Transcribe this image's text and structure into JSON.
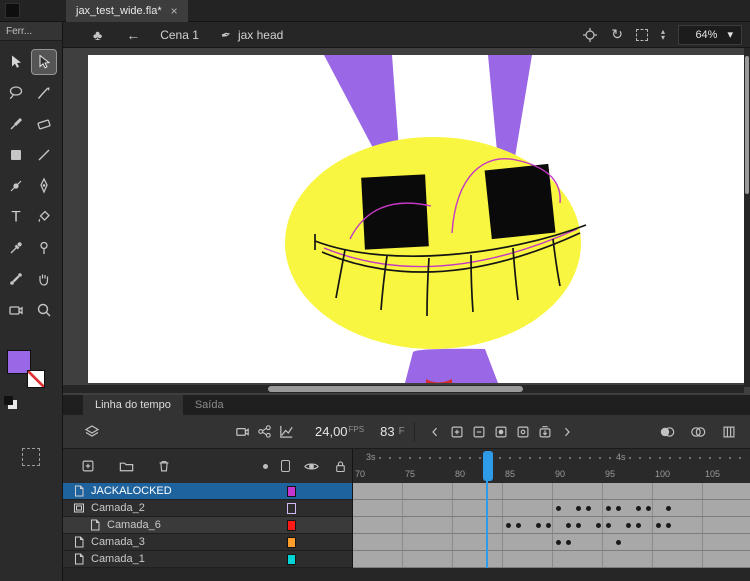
{
  "window": {
    "doc_tab": "jax_test_wide.fla*",
    "close": "×"
  },
  "tools_panel": {
    "title": "Ferr...",
    "tools": [
      "selection-tool",
      "subselection-tool",
      "lasso-tool",
      "fluid-brush-tool",
      "classic-brush-tool",
      "eraser-tool",
      "rectangle-tool",
      "line-tool",
      "width-tool",
      "pen-tool",
      "text-tool",
      "paint-bucket-tool",
      "eyedropper-tool",
      "asset-warp-tool",
      "bone-tool",
      "hand-tool",
      "camera-tool",
      "zoom-tool"
    ],
    "text_tool_glyph": "T"
  },
  "edit_bar": {
    "club_glyph": "♣",
    "back_glyph": "←",
    "scene_name": "Cena 1",
    "symbol_glyph": "✒",
    "symbol_name": "jax head",
    "rotate_glyph": "↻",
    "spinner_up": "▴",
    "spinner_down": "▾",
    "zoom_value": "64%",
    "zoom_caret": "▾"
  },
  "timeline": {
    "tabs": {
      "timeline": "Linha do tempo",
      "output": "Saída"
    },
    "fps_value": "24,00",
    "fps_unit": "FPS",
    "current_frame": "83",
    "frame_unit": "F",
    "first_frame": 70,
    "playhead_frame": 83,
    "ruler_numbers": [
      70,
      75,
      80,
      85,
      90,
      95,
      100,
      105
    ],
    "seconds_markers": [
      {
        "label": "3s",
        "frame": 71
      },
      {
        "label": "4s",
        "frame": 96
      }
    ],
    "layers": [
      {
        "name": "JACKALOCKED",
        "swatch": "#c436cf",
        "selected": true,
        "hollow": false,
        "indent": 0,
        "keyframes": []
      },
      {
        "name": "Camada_2",
        "swatch": "#cdb9f5",
        "selected": false,
        "hollow": true,
        "indent": 0,
        "keyframes": [
          90,
          92,
          93,
          95,
          96,
          98,
          99,
          101
        ]
      },
      {
        "name": "Camada_6",
        "swatch": "#ff1a1a",
        "selected": false,
        "hollow": false,
        "indent": 1,
        "keyframes": [
          85,
          86,
          88,
          89,
          91,
          92,
          94,
          95,
          97,
          98,
          100,
          101
        ]
      },
      {
        "name": "Camada_3",
        "swatch": "#ff9e2c",
        "selected": false,
        "hollow": false,
        "indent": 0,
        "keyframes": [
          90,
          91,
          96
        ]
      },
      {
        "name": "Camada_1",
        "swatch": "#00d4d4",
        "selected": false,
        "hollow": false,
        "indent": 0,
        "keyframes": []
      }
    ]
  },
  "canvas": {
    "stage_color": "#ffffff",
    "head_color": "#f8f640",
    "ear_color": "#9a67e6",
    "outline_color": "#c438c4",
    "mouth_color": "#141414",
    "accent_red": "#d32f2f"
  },
  "colors": {
    "selection_blue": "#1f639e",
    "playhead_blue": "#2e9be8"
  }
}
